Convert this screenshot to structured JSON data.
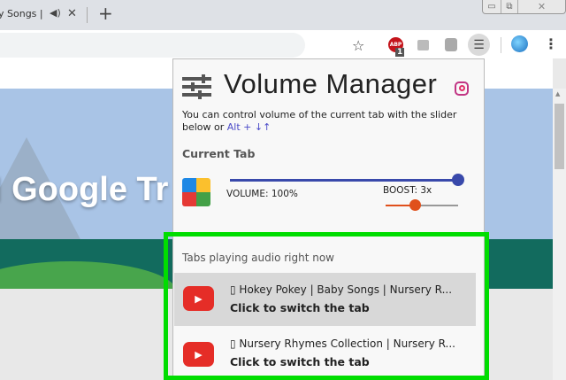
{
  "browser": {
    "tab_title": "y Songs |",
    "new_tab": "+",
    "close": "✕"
  },
  "toolbar": {
    "abp_badge": "1",
    "abp_label": "ABP"
  },
  "page": {
    "banner_text": "l Google Tr"
  },
  "popup": {
    "title": "Volume Manager",
    "description": "You can control volume of the current tab with the slider below or ",
    "shortcut": "Alt + ↓↑",
    "current_tab_heading": "Current Tab",
    "volume_label": "VOLUME: 100%",
    "volume_percent": 100,
    "boost_label": "BOOST: 3x",
    "boost_fraction": 0.4,
    "audio_heading": "Tabs playing audio right now",
    "tabs": [
      {
        "title": "▯ Hokey Pokey | Baby Songs | Nursery R...",
        "action": "Click to switch the tab"
      },
      {
        "title": "▯ Nursery Rhymes Collection | Nursery R...",
        "action": "Click to switch the tab"
      }
    ]
  },
  "colors": {
    "accent": "#3949ab",
    "boost": "#e0501c",
    "highlight": "#00dd00",
    "youtube": "#e52d27"
  }
}
